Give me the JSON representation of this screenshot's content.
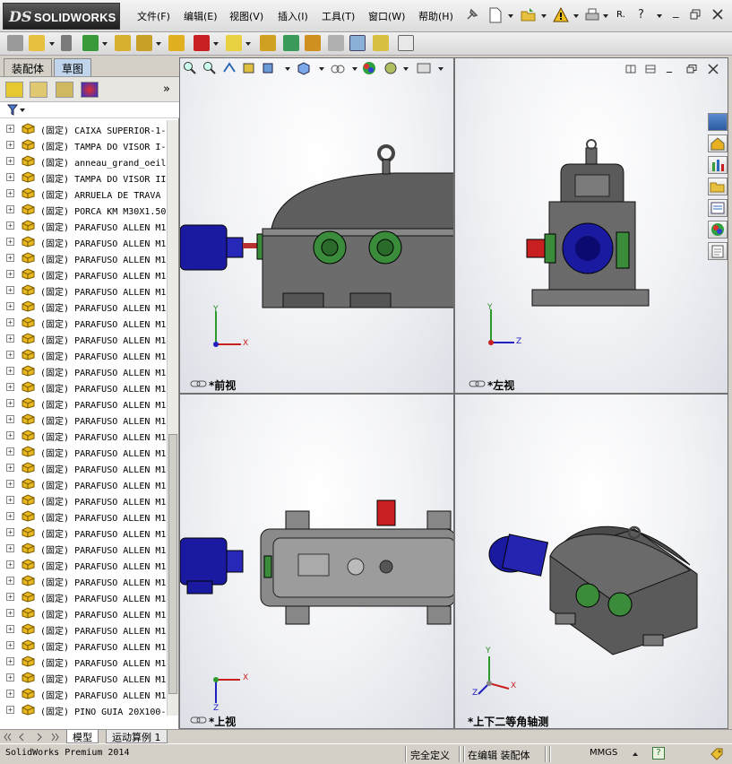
{
  "app": {
    "logo_ds": "DS",
    "logo_name": "SOLIDWORKS",
    "search_hint": "R."
  },
  "menu": [
    "文件(F)",
    "编辑(E)",
    "视图(V)",
    "插入(I)",
    "工具(T)",
    "窗口(W)",
    "帮助(H)"
  ],
  "panel": {
    "tabs": [
      "装配体",
      "草图"
    ],
    "active_tab": "草图",
    "more": "»"
  },
  "tree": [
    {
      "state": "(固定)",
      "name": "CAIXA SUPERIOR-1-"
    },
    {
      "state": "(固定)",
      "name": "TAMPA DO VISOR I-"
    },
    {
      "state": "(固定)",
      "name": "anneau_grand_oeil"
    },
    {
      "state": "(固定)",
      "name": "TAMPA DO VISOR II"
    },
    {
      "state": "(固定)",
      "name": "ARRUELA DE TRAVA"
    },
    {
      "state": "(固定)",
      "name": "PORCA KM M30X1.50"
    },
    {
      "state": "(固定)",
      "name": "PARAFUSO ALLEN M1"
    },
    {
      "state": "(固定)",
      "name": "PARAFUSO ALLEN M1"
    },
    {
      "state": "(固定)",
      "name": "PARAFUSO ALLEN M1"
    },
    {
      "state": "(固定)",
      "name": "PARAFUSO ALLEN M1"
    },
    {
      "state": "(固定)",
      "name": "PARAFUSO ALLEN M1"
    },
    {
      "state": "(固定)",
      "name": "PARAFUSO ALLEN M1"
    },
    {
      "state": "(固定)",
      "name": "PARAFUSO ALLEN M1"
    },
    {
      "state": "(固定)",
      "name": "PARAFUSO ALLEN M1"
    },
    {
      "state": "(固定)",
      "name": "PARAFUSO ALLEN M1"
    },
    {
      "state": "(固定)",
      "name": "PARAFUSO ALLEN M1"
    },
    {
      "state": "(固定)",
      "name": "PARAFUSO ALLEN M1"
    },
    {
      "state": "(固定)",
      "name": "PARAFUSO ALLEN M1"
    },
    {
      "state": "(固定)",
      "name": "PARAFUSO ALLEN M1"
    },
    {
      "state": "(固定)",
      "name": "PARAFUSO ALLEN M1"
    },
    {
      "state": "(固定)",
      "name": "PARAFUSO ALLEN M1"
    },
    {
      "state": "(固定)",
      "name": "PARAFUSO ALLEN M1"
    },
    {
      "state": "(固定)",
      "name": "PARAFUSO ALLEN M1"
    },
    {
      "state": "(固定)",
      "name": "PARAFUSO ALLEN M1"
    },
    {
      "state": "(固定)",
      "name": "PARAFUSO ALLEN M1"
    },
    {
      "state": "(固定)",
      "name": "PARAFUSO ALLEN M1"
    },
    {
      "state": "(固定)",
      "name": "PARAFUSO ALLEN M1"
    },
    {
      "state": "(固定)",
      "name": "PARAFUSO ALLEN M1"
    },
    {
      "state": "(固定)",
      "name": "PARAFUSO ALLEN M1"
    },
    {
      "state": "(固定)",
      "name": "PARAFUSO ALLEN M1"
    },
    {
      "state": "(固定)",
      "name": "PARAFUSO ALLEN M1"
    },
    {
      "state": "(固定)",
      "name": "PARAFUSO ALLEN M1"
    },
    {
      "state": "(固定)",
      "name": "PARAFUSO ALLEN M1"
    },
    {
      "state": "(固定)",
      "name": "PARAFUSO ALLEN M1"
    },
    {
      "state": "(固定)",
      "name": "PARAFUSO ALLEN M1"
    },
    {
      "state": "(固定)",
      "name": "PARAFUSO ALLEN M1"
    },
    {
      "state": "(固定)",
      "name": "PINO GUIA 20X100-"
    }
  ],
  "views": {
    "front": "*前视",
    "left": "*左视",
    "top": "*上视",
    "iso": "*上下二等角轴测"
  },
  "axes": {
    "x": "X",
    "y": "Y",
    "z": "Z"
  },
  "bottom_tabs": [
    "模型",
    "运动算例 1"
  ],
  "status": {
    "product": "SolidWorks Premium 2014",
    "definition": "完全定义",
    "editing": "在编辑 装配体",
    "units": "MMGS",
    "help": "?"
  },
  "colors": {
    "accent": "#3a6ea5",
    "part_yellow": "#e8b820",
    "motor_blue": "#1a1aa0",
    "housing_gray": "#6c6c6c",
    "coupling_green": "#3a8c3a",
    "spring_red": "#c82020"
  }
}
